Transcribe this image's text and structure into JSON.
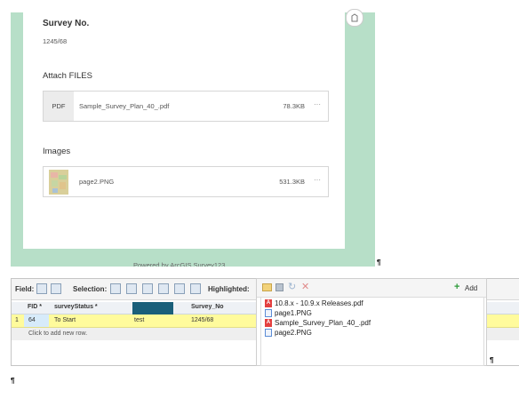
{
  "form": {
    "survey_no_label": "Survey No.",
    "survey_no_value": "1245/68",
    "attach_label": "Attach FILES",
    "attachment": {
      "thumb": "PDF",
      "name": "Sample_Survey_Plan_40_.pdf",
      "size": "78.3KB",
      "more": "···"
    },
    "images_label": "Images",
    "image": {
      "name": "page2.PNG",
      "size": "531.3KB",
      "more": "···"
    },
    "powered_by": "Powered by ArcGIS Survey123",
    "pin_icon": "pin-icon"
  },
  "pilcrows": [
    "¶",
    "¶",
    "¶"
  ],
  "table": {
    "field_label": "Field:",
    "selection_label": "Selection:",
    "highlighted_label": "Highlighted:",
    "columns": [
      "FID *",
      "surveyStatus *",
      "",
      "Survey_No"
    ],
    "row": {
      "num": "1",
      "fid": "64",
      "status": "To Start",
      "col3": "test",
      "survey_no": "1245/68"
    },
    "add_row": "Click to add new row.",
    "col3_color": "#1a5f7a"
  },
  "attachments": {
    "add_label": "Add",
    "items": [
      {
        "name": "10.8.x - 10.9.x Releases.pdf",
        "type": "pdf"
      },
      {
        "name": "page1.PNG",
        "type": "png"
      },
      {
        "name": "Sample_Survey_Plan_40_.pdf",
        "type": "pdf"
      },
      {
        "name": "page2.PNG",
        "type": "png"
      }
    ]
  }
}
